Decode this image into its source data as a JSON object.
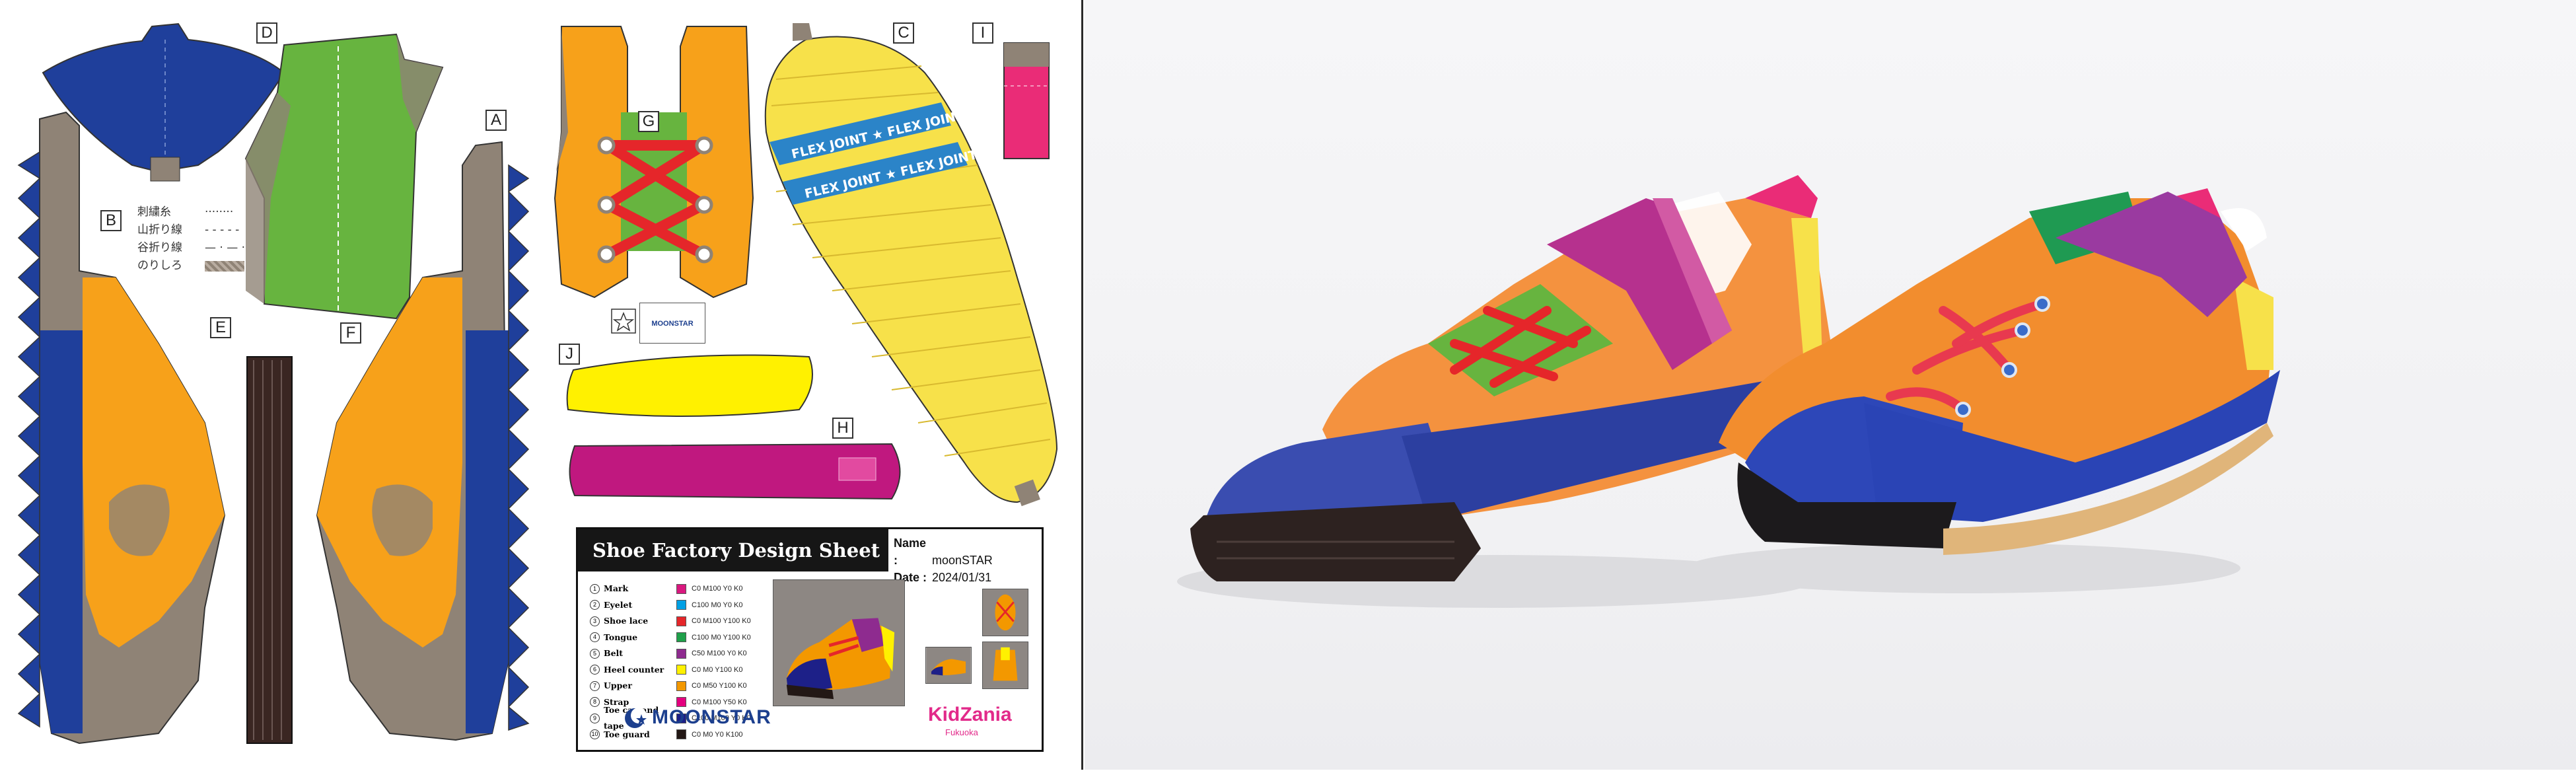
{
  "parts": {
    "labels": {
      "a": "A",
      "b": "B",
      "c": "C",
      "d": "D",
      "e": "E",
      "f": "F",
      "g": "G",
      "h": "H",
      "i": "I",
      "j": "J"
    },
    "sole_text": "FLEX JOINT ★ FLEX JOINT",
    "logo_text": "MOONSTAR"
  },
  "legend": [
    {
      "label": "刺繍糸",
      "sample": "········"
    },
    {
      "label": "山折り線",
      "sample": "- - - - -"
    },
    {
      "label": "谷折り線",
      "sample": "— · — ·"
    },
    {
      "label": "のりしろ",
      "sample": ""
    }
  ],
  "design_sheet": {
    "title": "Shoe Factory Design Sheet",
    "name_label": "Name :",
    "name_value": "moonSTAR",
    "date_label": "Date :",
    "date_value": "2024/01/31",
    "items": [
      {
        "num": "1",
        "name": "Mark",
        "cmyk": "C0 M100 Y0 K0",
        "color": "#d9187f"
      },
      {
        "num": "2",
        "name": "Eyelet",
        "cmyk": "C100 M0 Y0 K0",
        "color": "#00a0e4"
      },
      {
        "num": "3",
        "name": "Shoe lace",
        "cmyk": "C0 M100 Y100 K0",
        "color": "#e5262a"
      },
      {
        "num": "4",
        "name": "Tongue",
        "cmyk": "C100 M0 Y100 K0",
        "color": "#1fa04a"
      },
      {
        "num": "5",
        "name": "Belt",
        "cmyk": "C50 M100 Y0 K0",
        "color": "#8e2b8f"
      },
      {
        "num": "6",
        "name": "Heel counter",
        "cmyk": "C0 M0 Y100 K0",
        "color": "#fff100"
      },
      {
        "num": "7",
        "name": "Upper",
        "cmyk": "C0 M50 Y100 K0",
        "color": "#f39800"
      },
      {
        "num": "8",
        "name": "Strap",
        "cmyk": "C0 M100 Y50 K0",
        "color": "#e4007f"
      },
      {
        "num": "9",
        "name": "Toe cap and tape",
        "cmyk": "C100 M100 Y0 K0",
        "color": "#1d2088"
      },
      {
        "num": "10",
        "name": "Toe guard",
        "cmyk": "C0 M0 Y0 K100",
        "color": "#231815"
      }
    ],
    "brand_moonstar": "MOONSTAR",
    "brand_kidzania": "KidZania",
    "brand_kidzania_sub": "Fukuoka"
  },
  "colors": {
    "navy": "#1f3f9b",
    "gray_brown": "#8f8376",
    "orange": "#f7a11a",
    "green": "#67b43f",
    "yellow": "#f7e14a",
    "magenta": "#c0187f",
    "pink": "#ea2c77",
    "red": "#e5262a",
    "dark_brown": "#3a2622"
  }
}
